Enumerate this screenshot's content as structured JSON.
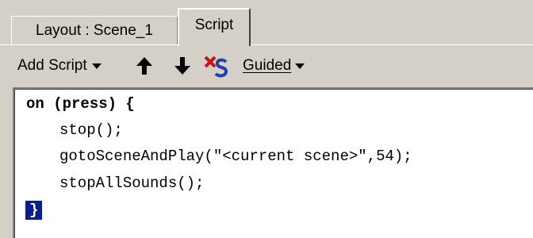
{
  "tabs": {
    "layout_label": "Layout : Scene_1",
    "script_label": "Script"
  },
  "toolbar": {
    "add_script_label": "Add Script",
    "move_up_icon": "up-arrow",
    "move_down_icon": "down-arrow",
    "check_syntax_icon": "check-syntax",
    "guided_label": "Guided"
  },
  "code": {
    "lines": [
      "on (press) {",
      "stop();",
      "gotoSceneAndPlay(\"<current scene>\",54);",
      "stopAllSounds();",
      "}"
    ]
  },
  "colors": {
    "chrome": "#d4d0c8",
    "editor_bg": "#ffffff",
    "selection": "#0a1e8c",
    "check_red": "#cc1111",
    "check_blue": "#1f3fb0"
  }
}
